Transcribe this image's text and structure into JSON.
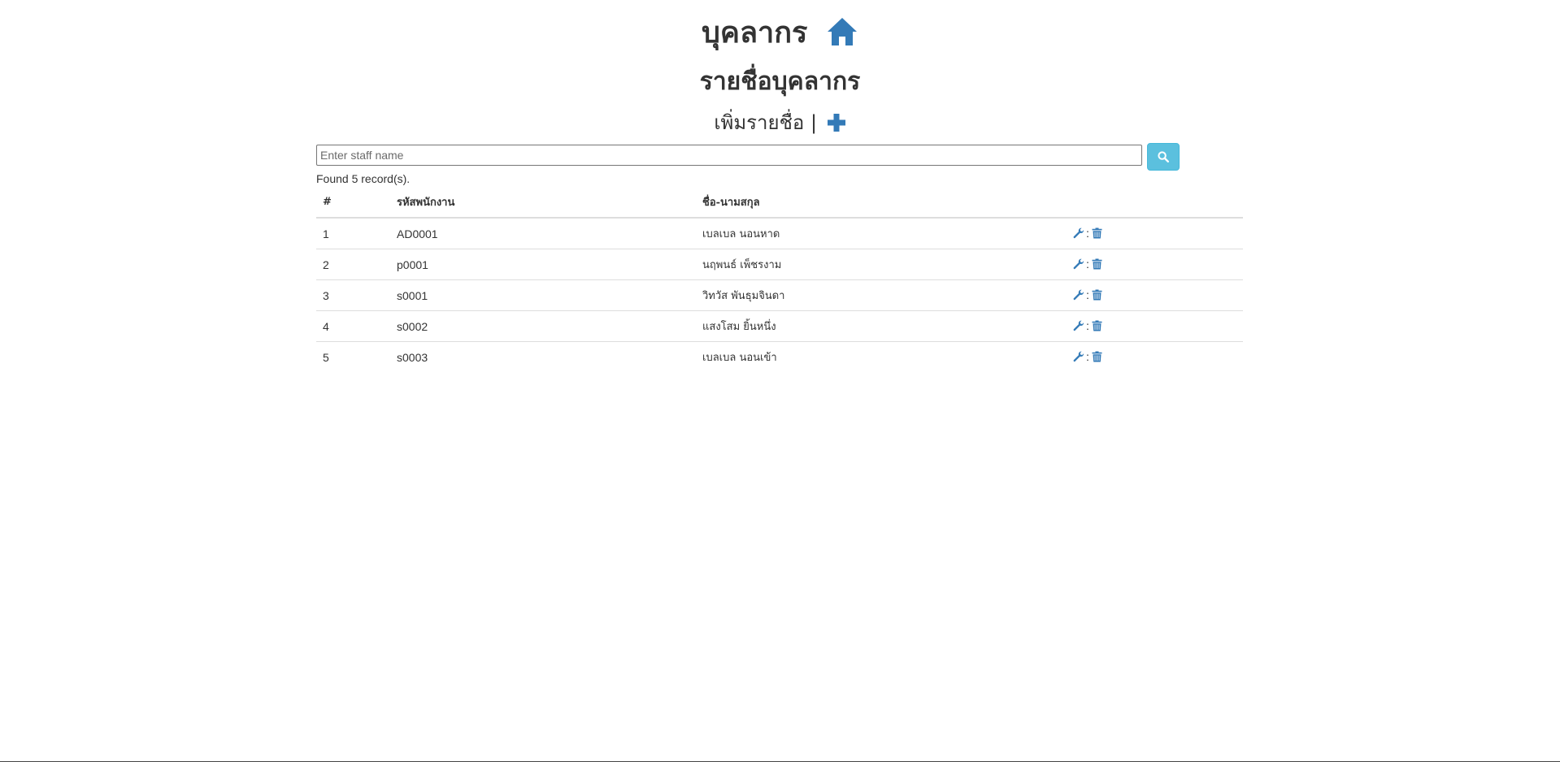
{
  "header": {
    "title": "บุคลากร",
    "subtitle": "รายชื่อบุคลากร",
    "add_label": "เพิ่มรายชื่อ",
    "add_separator": "|"
  },
  "search": {
    "placeholder": "Enter staff name",
    "value": ""
  },
  "result": {
    "found_text": "Found 5 record(s)."
  },
  "table": {
    "columns": [
      "#",
      "รหัสพนักงาน",
      "ชื่อ-นามสกุล",
      ""
    ],
    "action_separator": ":",
    "rows": [
      {
        "num": "1",
        "code": "AD0001",
        "name": "เบลเบล นอนหาด"
      },
      {
        "num": "2",
        "code": "p0001",
        "name": "นฤพนธ์ เพ็ชรงาม"
      },
      {
        "num": "3",
        "code": "s0001",
        "name": "วิทวัส พันธุมจินดา"
      },
      {
        "num": "4",
        "code": "s0002",
        "name": "แสงโสม ยิ้นหนึ่ง"
      },
      {
        "num": "5",
        "code": "s0003",
        "name": "เบลเบล นอนเข้า"
      }
    ]
  },
  "icons": {
    "home": "home-icon",
    "add": "plus-icon",
    "search": "search-icon",
    "edit": "wrench-icon",
    "delete": "trash-icon"
  },
  "colors": {
    "icon_blue": "#337ab7",
    "search_button": "#5bc0de",
    "text": "#333333",
    "border": "#dddddd"
  }
}
